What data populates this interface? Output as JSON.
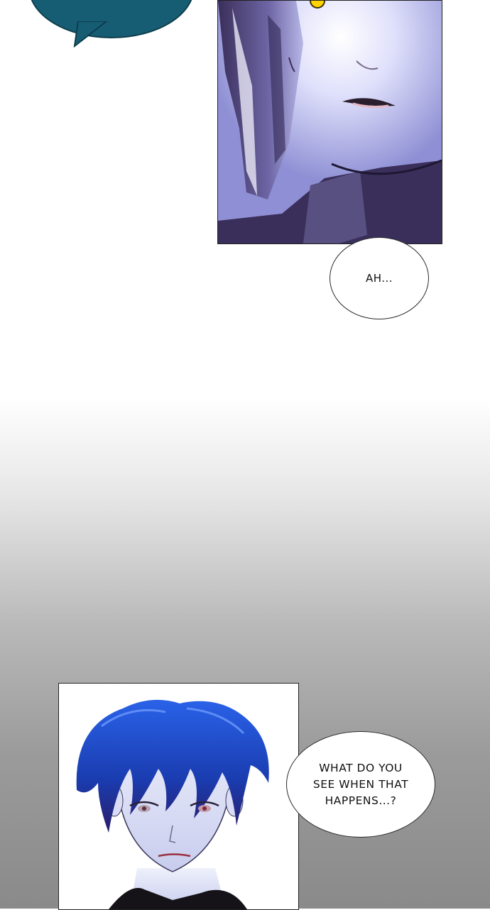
{
  "bubbles": {
    "ah": "AH...",
    "question": "WHAT DO YOU\nSEE WHEN THAT\nHAPPENS...?"
  },
  "colors": {
    "top_bubble": "#165d74",
    "panel1_light": "#c7c8ef",
    "panel1_shadow": "#3a2f5a",
    "hair_blue": "#1f4fd1",
    "skin_lavender": "#d9dcf4",
    "eye_yellow": "#ffd400"
  }
}
